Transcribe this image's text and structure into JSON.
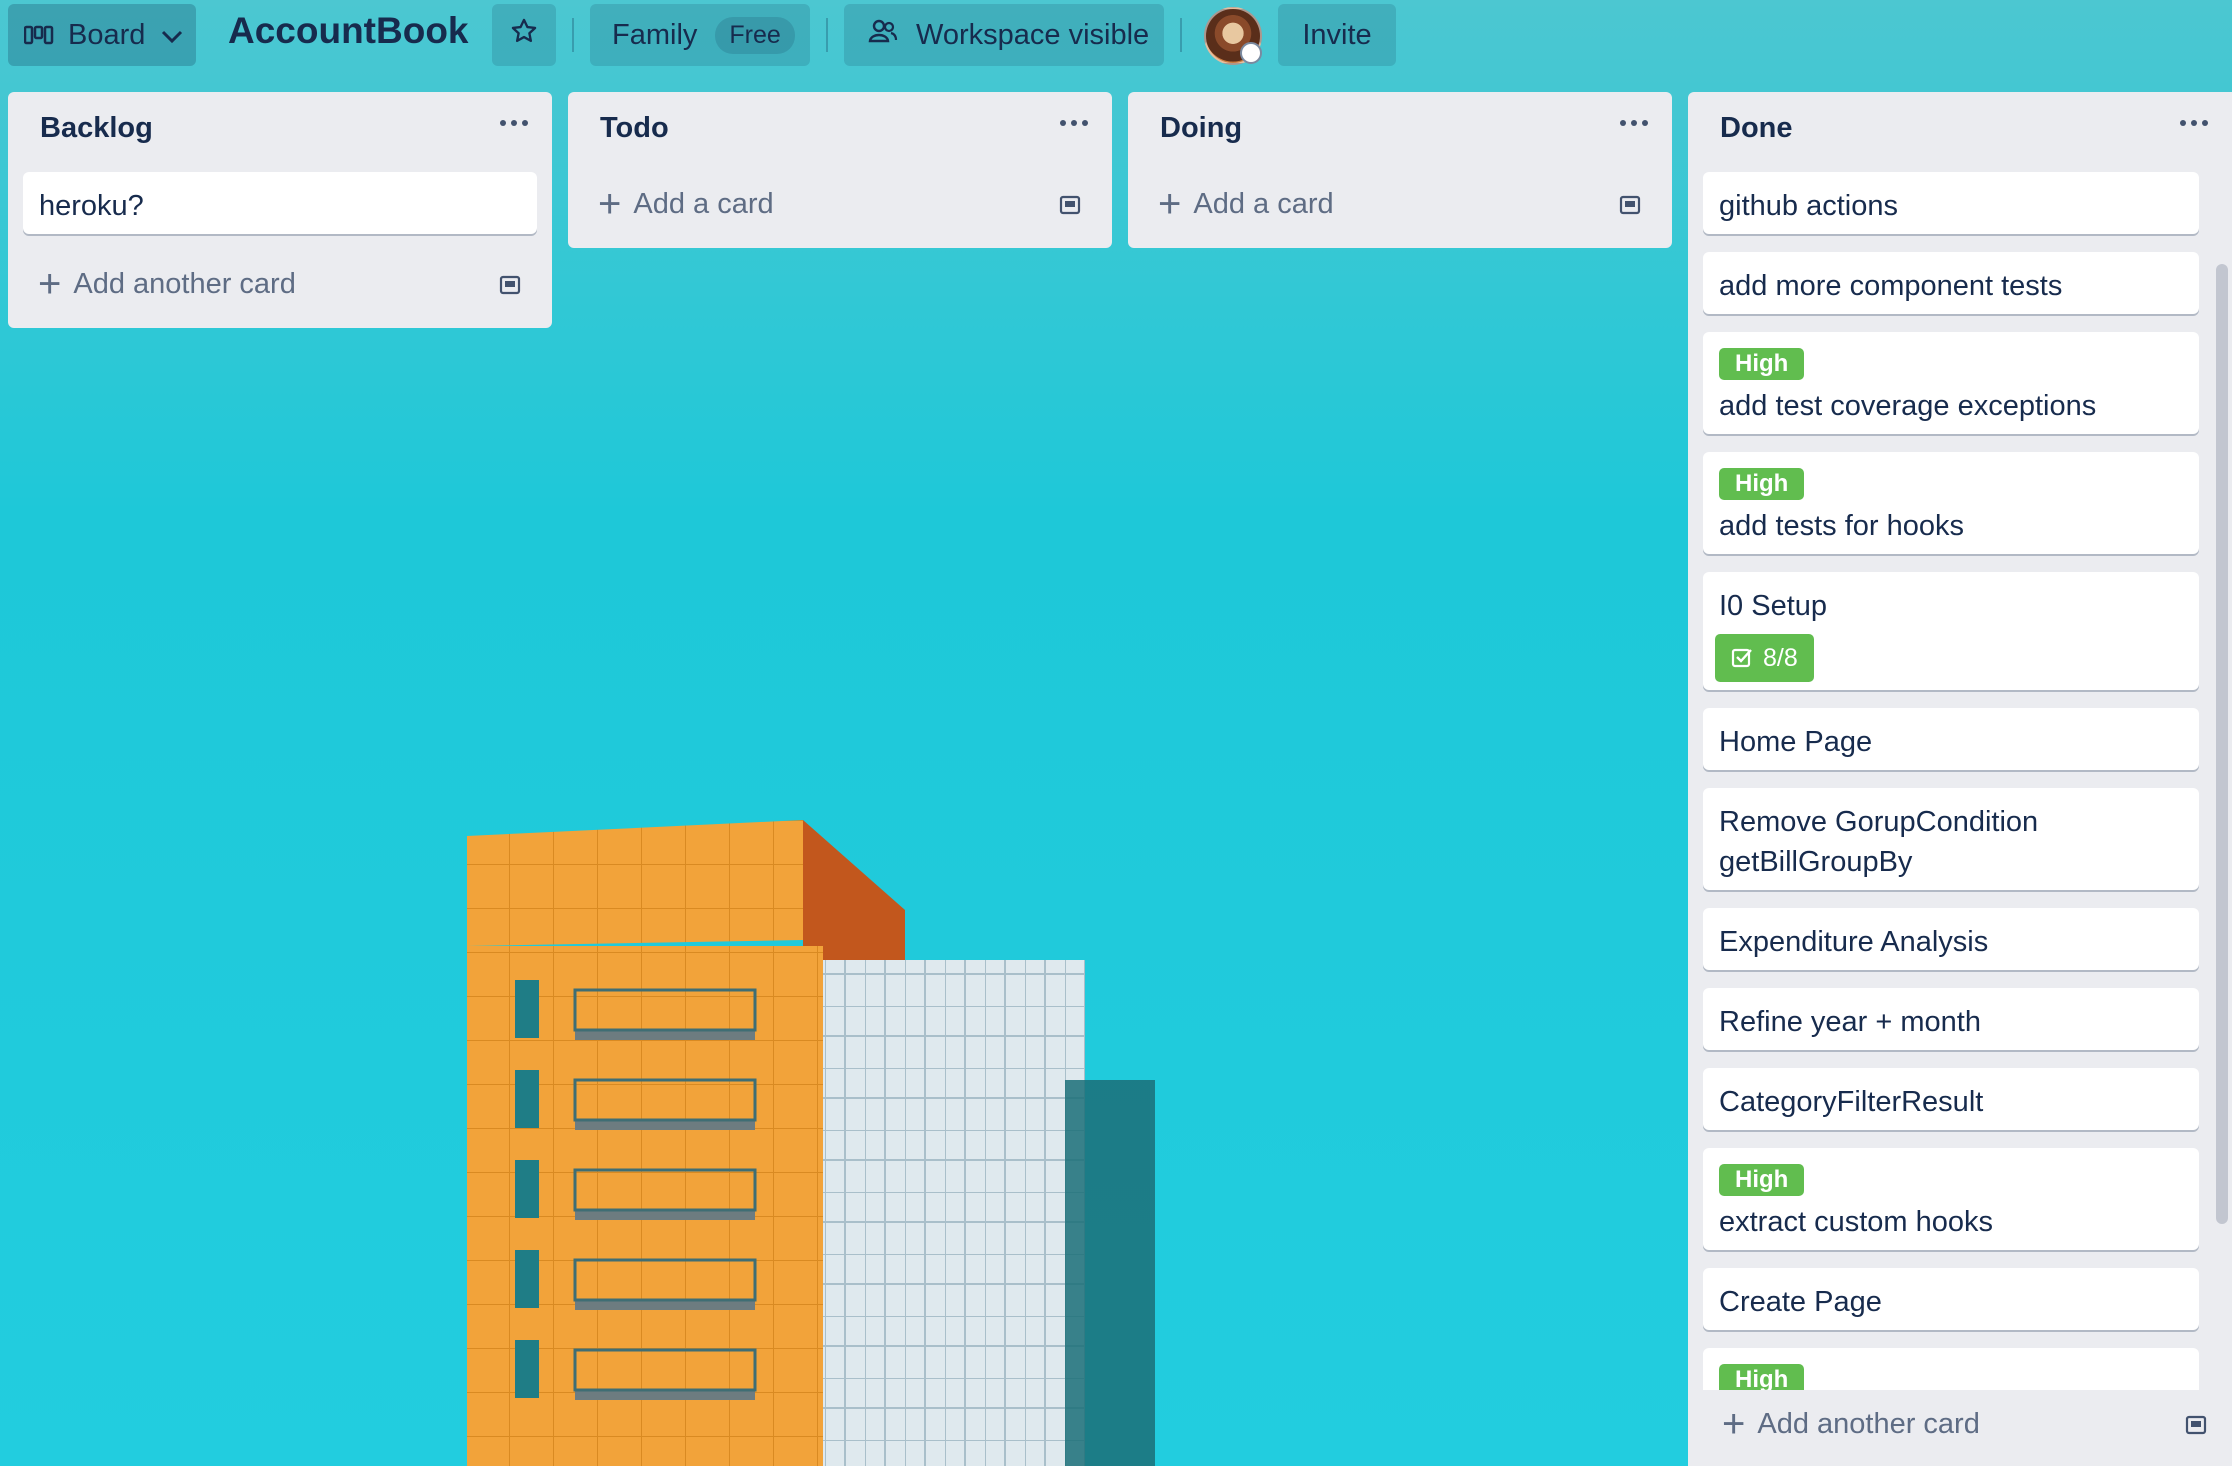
{
  "header": {
    "view_label": "Board",
    "board_title": "AccountBook",
    "workspace_name": "Family",
    "plan_badge": "Free",
    "visibility_label": "Workspace visible",
    "invite_label": "Invite",
    "icons": [
      "board-icon",
      "chevron-down-icon",
      "star-icon",
      "people-icon",
      "avatar"
    ]
  },
  "lists": {
    "backlog": {
      "title": "Backlog",
      "cards": [
        {
          "title": "heroku?"
        }
      ],
      "add_label": "Add another card"
    },
    "todo": {
      "title": "Todo",
      "add_label": "Add a card"
    },
    "doing": {
      "title": "Doing",
      "add_label": "Add a card"
    },
    "done": {
      "title": "Done",
      "cards": [
        {
          "title": "github actions"
        },
        {
          "title": "add more component tests"
        },
        {
          "label": "High",
          "title": "add test coverage exceptions"
        },
        {
          "label": "High",
          "title": "add tests for hooks"
        },
        {
          "title": "I0 Setup",
          "checklist": "8/8"
        },
        {
          "title": "Home Page"
        },
        {
          "title": "Remove GorupCondition getBillGroupBy"
        },
        {
          "title": "Expenditure Analysis"
        },
        {
          "title": "Refine year + month"
        },
        {
          "title": "CategoryFilterResult"
        },
        {
          "label": "High",
          "title": "extract custom hooks"
        },
        {
          "title": "Create Page"
        },
        {
          "label": "High"
        }
      ],
      "add_label": "Add another card"
    }
  },
  "colors": {
    "background": "#22cddf",
    "list_bg": "#ebecf0",
    "label_green": "#61bd4f",
    "text": "#172b4d"
  }
}
